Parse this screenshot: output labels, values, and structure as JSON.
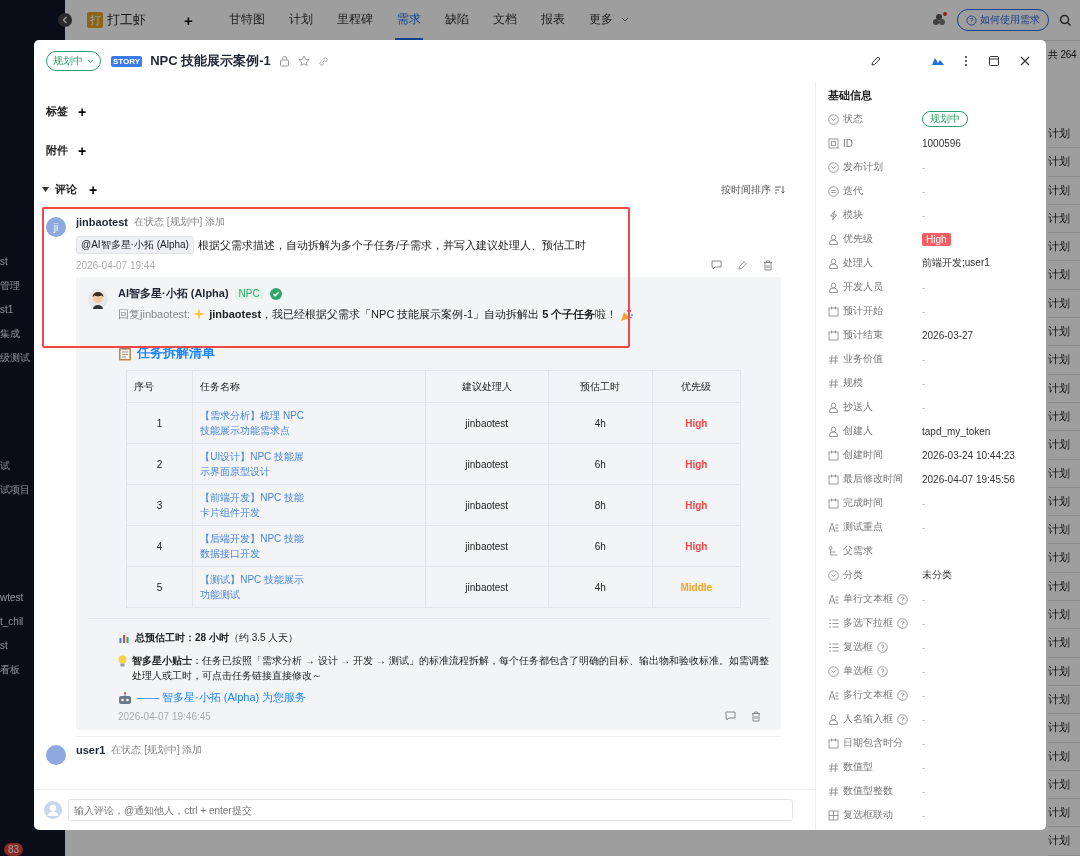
{
  "app_bar": {
    "logo": "打",
    "project": "打工虾",
    "add": "+",
    "help": "如何使用需求",
    "nav": [
      {
        "label": "甘特图",
        "selected": false
      },
      {
        "label": "计划",
        "selected": false
      },
      {
        "label": "里程碑",
        "selected": false
      },
      {
        "label": "需求",
        "selected": true
      },
      {
        "label": "缺陷",
        "selected": false
      },
      {
        "label": "文档",
        "selected": false
      },
      {
        "label": "报表",
        "selected": false
      },
      {
        "label": "更多",
        "selected": false
      }
    ]
  },
  "sidebar_groups": [
    [
      "st",
      "管理",
      "st1",
      "集成",
      "级测试"
    ],
    [
      "试",
      "试项目"
    ],
    [
      "wtest",
      "t_chil",
      "st",
      "看板"
    ]
  ],
  "sidebar_badge": "83",
  "list_behind": {
    "count": "共 264",
    "cells": [
      "计划",
      "计划",
      "计划",
      "计划",
      "计划",
      "计划",
      "计划",
      "计划",
      "计划",
      "计划",
      "计划",
      "计划",
      "计划",
      "计划",
      "计划",
      "计划",
      "计划",
      "计划",
      "计划",
      "计划",
      "计划",
      "计划",
      "计划",
      "计划",
      "计划",
      "计划"
    ]
  },
  "modal": {
    "header": {
      "status": "规划中",
      "tag": "STORY",
      "title": "NPC 技能展示案例-1"
    },
    "sections": [
      {
        "label": "标签",
        "add": "+"
      },
      {
        "label": "附件",
        "add": "+"
      }
    ],
    "comments_section": {
      "label": "评论",
      "add": "+",
      "sort": "按时间排序"
    },
    "annotation": {
      "kind": "highlight-box"
    },
    "comments": [
      {
        "author": "jinbaotest",
        "avatar": "ji",
        "meta": "在状态 [规划中] 添加",
        "mention": "@AI智多星·小拓 (Alpha)",
        "text": "根据父需求描述，自动拆解为多个子任务/子需求，并写入建议处理人、预估工时",
        "time": "2026-04-07 19:44",
        "reply": {
          "author": "AI智多星·小拓 (Alpha)",
          "badge": "NPC",
          "verified": true,
          "prefix": "回复jinbaotest:",
          "text": "**jinbaotest**，我已经根据父需求「NPC 技能展示案例-1」自动拆解出 **5 个子任务**啦！",
          "heading": "任务拆解清单",
          "table": {
            "columns": [
              "序号",
              "任务名称",
              "建议处理人",
              "预估工时",
              "优先级"
            ],
            "rows": [
              {
                "no": "1",
                "name": "【需求分析】梳理 NPC 技能展示功能需求点",
                "assignee": "jinbaotest",
                "hours": "4h",
                "priority": "High",
                "kind": "high"
              },
              {
                "no": "2",
                "name": "【UI设计】NPC 技能展示界面原型设计",
                "assignee": "jinbaotest",
                "hours": "6h",
                "priority": "High",
                "kind": "high"
              },
              {
                "no": "3",
                "name": "【前端开发】NPC 技能卡片组件开发",
                "assignee": "jinbaotest",
                "hours": "8h",
                "priority": "High",
                "kind": "high"
              },
              {
                "no": "4",
                "name": "【后端开发】NPC 技能数据接口开发",
                "assignee": "jinbaotest",
                "hours": "6h",
                "priority": "High",
                "kind": "high"
              },
              {
                "no": "5",
                "name": "【测试】NPC 技能展示功能测试",
                "assignee": "jinbaotest",
                "hours": "4h",
                "priority": "Middle",
                "kind": "middle"
              }
            ]
          },
          "total": "**总预估工时：28 小时**（约 3.5 人天）",
          "tip": "**智多星小贴士**：任务已按照「需求分析 → 设计 → 开发 → 测试」的标准流程拆解，每个任务都包含了明确的目标、输出物和验收标准。如需调整处理人或工时，可点击任务链接直接修改～",
          "signature": "—— 智多星·小拓 (Alpha) 为您服务",
          "time": "2026-04-07 19:46:45"
        }
      },
      {
        "author": "user1",
        "meta": "在状态 [规划中] 添加"
      }
    ],
    "comment_input": {
      "placeholder": "输入评论，@通知他人，ctrl + enter提交"
    },
    "info": {
      "title": "基础信息",
      "fields": [
        {
          "label": "状态",
          "value": "规划中",
          "kind": "status"
        },
        {
          "label": "ID",
          "value": "1000596",
          "kind": "text"
        },
        {
          "label": "发布计划",
          "value": "-",
          "kind": "empty"
        },
        {
          "label": "迭代",
          "value": "-",
          "kind": "empty"
        },
        {
          "label": "模块",
          "value": "-",
          "kind": "empty"
        },
        {
          "label": "优先级",
          "value": "High",
          "kind": "priority"
        },
        {
          "label": "处理人",
          "value": "前端开发;user1",
          "kind": "text"
        },
        {
          "label": "开发人员",
          "value": "-",
          "kind": "empty"
        },
        {
          "label": "预计开始",
          "value": "-",
          "kind": "empty"
        },
        {
          "label": "预计结束",
          "value": "2026-03-27",
          "kind": "text"
        },
        {
          "label": "业务价值",
          "value": "-",
          "kind": "empty"
        },
        {
          "label": "规模",
          "value": "-",
          "kind": "empty"
        },
        {
          "label": "抄送人",
          "value": "-",
          "kind": "empty"
        },
        {
          "label": "创建人",
          "value": "tapd_my_token",
          "kind": "text"
        },
        {
          "label": "创建时间",
          "value": "2026-03-24 10:44:23",
          "kind": "text"
        },
        {
          "label": "最后修改时间",
          "value": "2026-04-07 19:45:56",
          "kind": "text"
        },
        {
          "label": "完成时间",
          "value": "-",
          "kind": "empty"
        },
        {
          "label": "测试重点",
          "value": "-",
          "kind": "empty"
        },
        {
          "label": "父需求",
          "kind": "none"
        },
        {
          "label": "分类",
          "value": "未分类",
          "kind": "text"
        },
        {
          "label": "单行文本框",
          "value": "-",
          "kind": "empty",
          "help": true
        },
        {
          "label": "多选下拉框",
          "value": "-",
          "kind": "empty",
          "help": true
        },
        {
          "label": "复选框",
          "value": "-",
          "kind": "empty",
          "help": true
        },
        {
          "label": "单选框",
          "value": "-",
          "kind": "empty",
          "help": true
        },
        {
          "label": "多行文本框",
          "value": "-",
          "kind": "empty",
          "help": true
        },
        {
          "label": "人名输入框",
          "value": "-",
          "kind": "empty",
          "help": true
        },
        {
          "label": "日期包含时分",
          "value": "-",
          "kind": "empty"
        },
        {
          "label": "数值型",
          "value": "-",
          "kind": "empty"
        },
        {
          "label": "数值型整数",
          "value": "-",
          "kind": "empty"
        },
        {
          "label": "复选框联动",
          "value": "-",
          "kind": "empty"
        }
      ]
    }
  }
}
